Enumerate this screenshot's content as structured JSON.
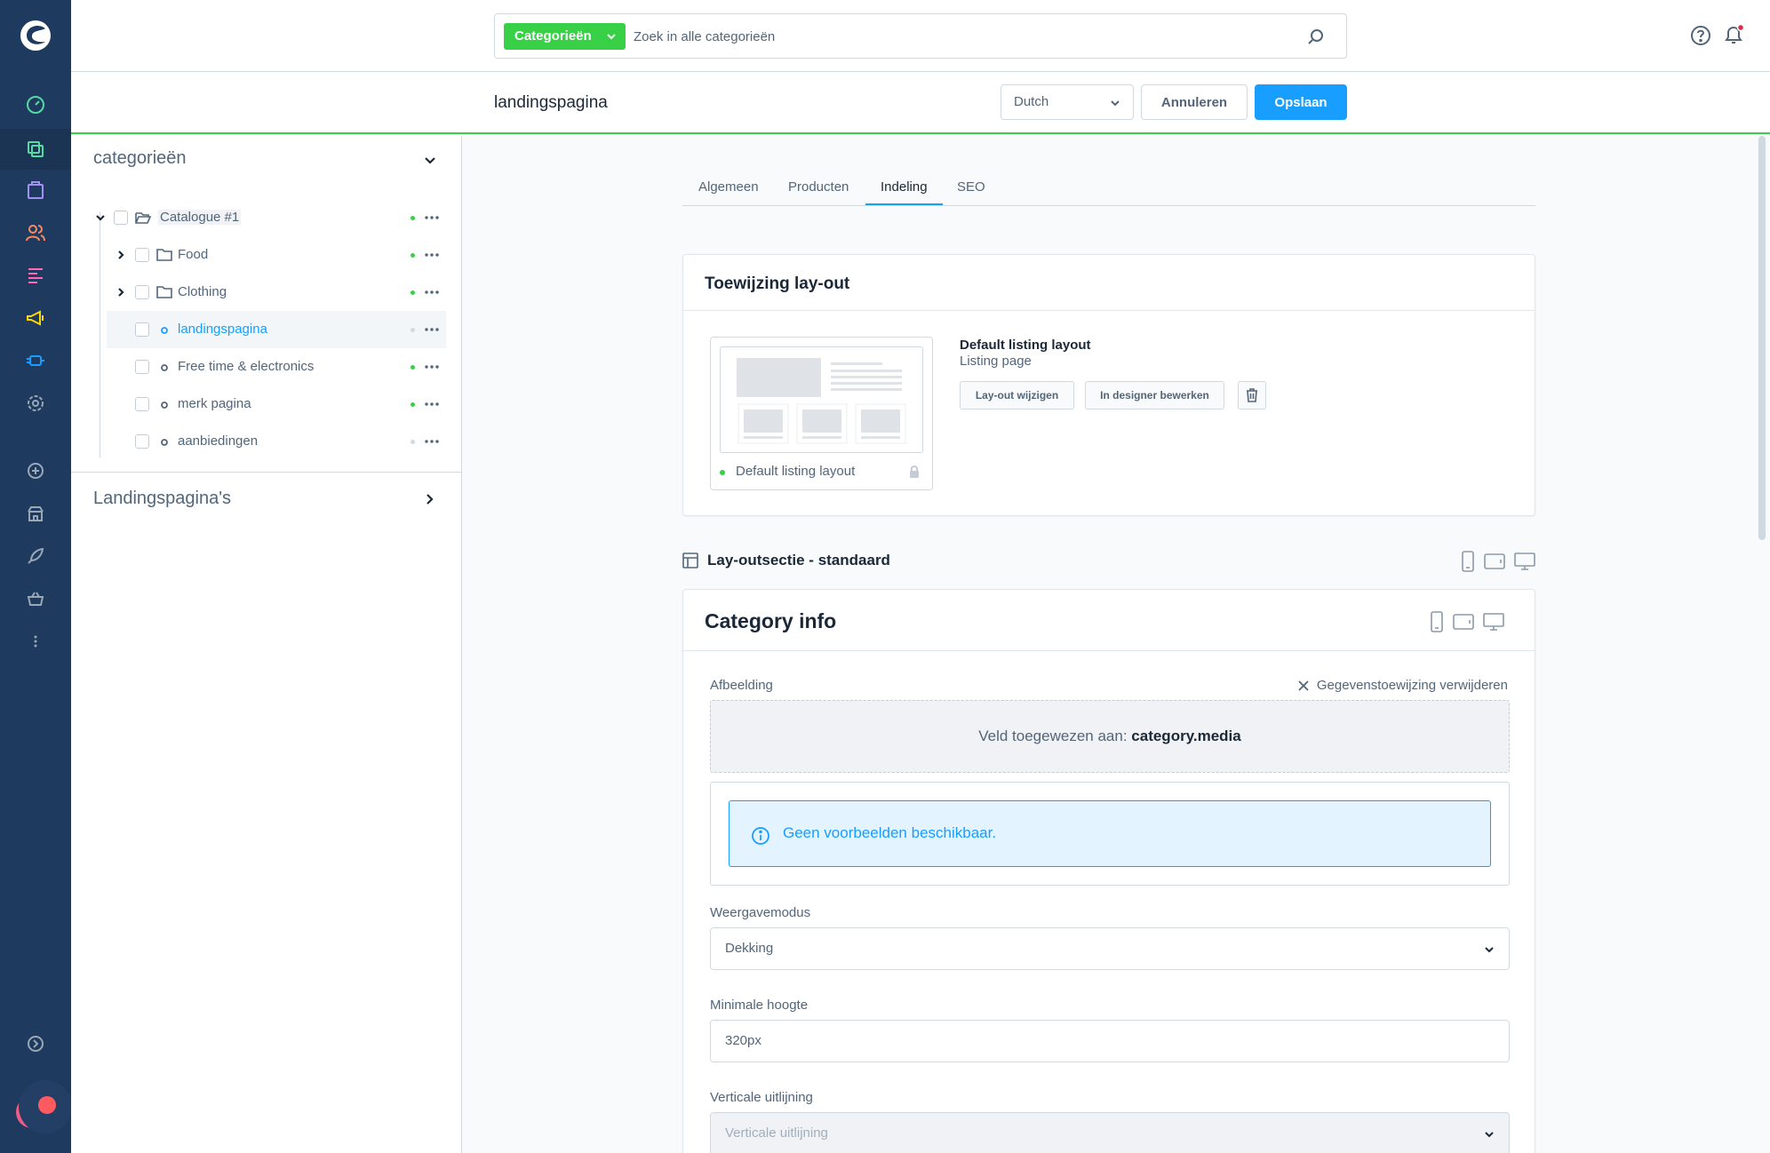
{
  "search": {
    "type_label": "Categorieën",
    "placeholder": "Zoek in alle categorieën"
  },
  "smartbar": {
    "title": "landingspagina",
    "language": "Dutch",
    "cancel_label": "Annuleren",
    "save_label": "Opslaan"
  },
  "sidebar": {
    "header": "categorieën",
    "tree": [
      {
        "label": "Catalogue #1",
        "level": 0,
        "type": "folder-open",
        "status": "active"
      },
      {
        "label": "Food",
        "level": 1,
        "type": "folder",
        "status": "active"
      },
      {
        "label": "Clothing",
        "level": 1,
        "type": "folder",
        "status": "active"
      },
      {
        "label": "landingspagina",
        "level": 1,
        "type": "page",
        "status": "inactive",
        "selected": true
      },
      {
        "label": "Free time & electronics",
        "level": 1,
        "type": "page",
        "status": "active"
      },
      {
        "label": "merk pagina",
        "level": 1,
        "type": "page",
        "status": "active"
      },
      {
        "label": "aanbiedingen",
        "level": 1,
        "type": "page",
        "status": "inactive"
      }
    ],
    "section2": "Landingspagina's"
  },
  "tabs": [
    {
      "label": "Algemeen"
    },
    {
      "label": "Producten"
    },
    {
      "label": "Indeling",
      "active": true
    },
    {
      "label": "SEO"
    }
  ],
  "layout_card": {
    "title": "Toewijzing lay-out",
    "preview_caption": "Default listing layout",
    "layout_name": "Default listing layout",
    "layout_type": "Listing page",
    "change_button": "Lay-out wijzigen",
    "designer_button": "In designer bewerken"
  },
  "section": {
    "title": "Lay-outsectie - standaard"
  },
  "block": {
    "title": "Category info",
    "image_label": "Afbeelding",
    "remove_mapping": "Gegevenstoewijzing verwijderen",
    "mapped_prefix": "Veld toegewezen aan:",
    "mapped_field": "category.media",
    "no_preview": "Geen voorbeelden beschikbaar.",
    "display_mode_label": "Weergavemodus",
    "display_mode_value": "Dekking",
    "min_height_label": "Minimale hoogte",
    "min_height_value": "320px",
    "vertical_align_label": "Verticale uitlijning",
    "vertical_align_placeholder": "Verticale uitlijning"
  },
  "colors": {
    "admin_menu": "#1e3a5f",
    "accent_green": "#37d046",
    "primary_blue": "#189eff",
    "notification": "#de294c"
  },
  "icons": [
    "dashboard-icon",
    "catalogue-icon",
    "orders-icon",
    "customers-icon",
    "content-icon",
    "marketing-icon",
    "extensions-icon",
    "settings-icon",
    "add-icon",
    "sales-channel-icon",
    "rocket-icon",
    "basket-icon",
    "more-icon",
    "help-icon",
    "bell-icon",
    "search-icon"
  ]
}
